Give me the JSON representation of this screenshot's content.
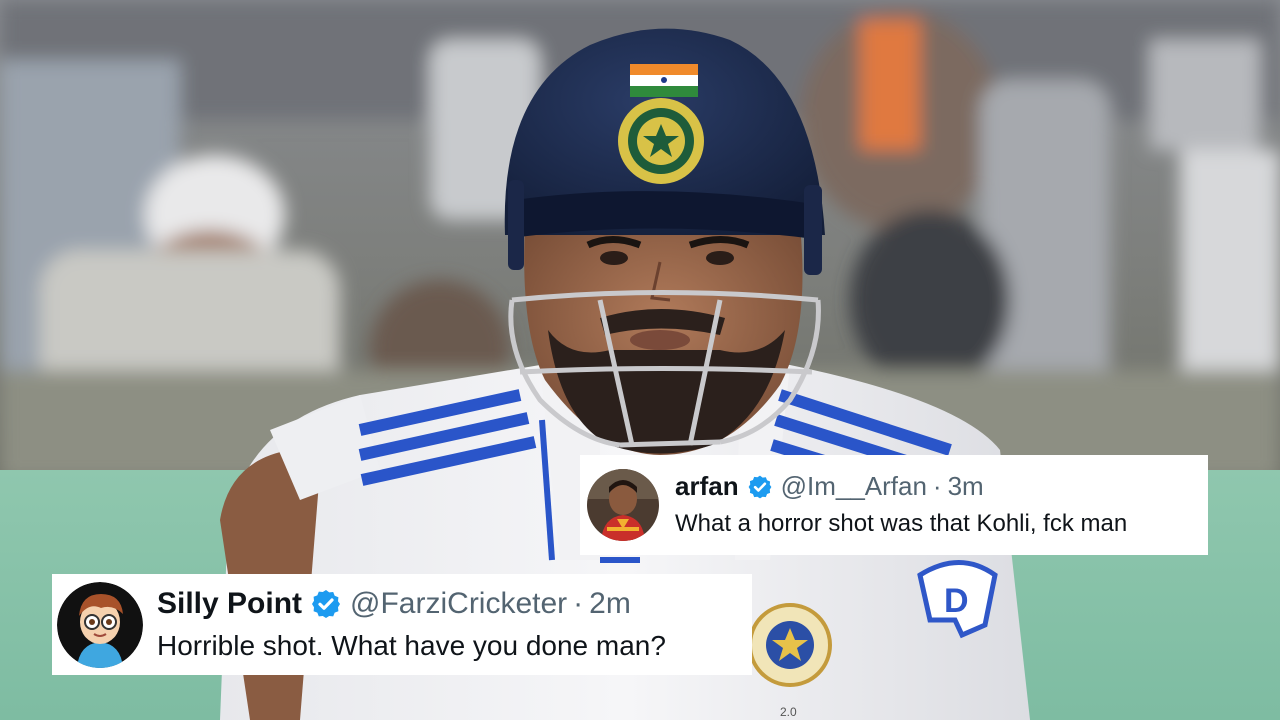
{
  "tweets": [
    {
      "display_name": "arfan",
      "handle": "@Im__Arfan",
      "separator": "·",
      "time": "3m",
      "text": "What a horror shot was that Kohli, fck man",
      "verified": true
    },
    {
      "display_name": "Silly Point",
      "handle": "@FarziCricketer",
      "separator": "·",
      "time": "2m",
      "text": "Horrible shot. What have you done man?",
      "verified": true
    }
  ],
  "colors": {
    "verified_badge": "#1d9bf0",
    "handle_gray": "#536471",
    "text_dark": "#0f1419",
    "jersey_stripe": "#2a55c9",
    "helmet_navy": "#1c2b4f"
  },
  "icons": {
    "verified": "verified-badge-icon",
    "helmet_emblem": "bcci-emblem-icon",
    "flag": "india-flag-icon"
  }
}
